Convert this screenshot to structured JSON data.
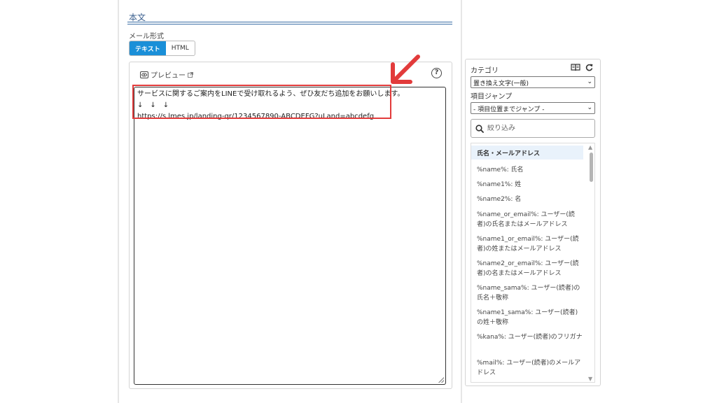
{
  "editor": {
    "section_title": "本文",
    "format_label": "メール形式",
    "format_options": [
      "テキスト",
      "HTML"
    ],
    "selected_format": "テキスト",
    "preview_label": "プレビュー",
    "help_symbol": "?",
    "body_lines": [
      "サービスに関するご案内をLINEで受け取れるよう、ぜひ友だち追加をお願いします。",
      "↓　↓　↓",
      "https://s.lmes.jp/landing-qr/1234567890-ABCDEFG?uLand=abcdefg"
    ]
  },
  "sidebar": {
    "category_label": "カテゴリ",
    "category_value": "置き換え文字(一般)",
    "jump_label": "項目ジャンプ",
    "jump_value": "- 項目位置までジャンプ -",
    "search_placeholder": "絞り込み",
    "list_header": "氏名・メールアドレス",
    "items": [
      "%name%: 氏名",
      "%name1%: 姓",
      "%name2%: 名",
      "%name_or_email%: ユーザー(読者)の氏名またはメールアドレス",
      "%name1_or_email%: ユーザー(読者)の姓またはメールアドレス",
      "%name2_or_email%: ユーザー(読者)の名またはメールアドレス",
      "%name_sama%: ユーザー(読者)の氏名＋敬称",
      "%name1_sama%: ユーザー(読者)の姓＋敬称",
      "%kana%: ユーザー(読者)のフリガナ",
      "%mail%: ユーザー(読者)のメールアドレス"
    ]
  },
  "colors": {
    "accent": "#1a8fd8",
    "highlight": "#e23b3b",
    "title_rule": "#3a6ea5"
  }
}
